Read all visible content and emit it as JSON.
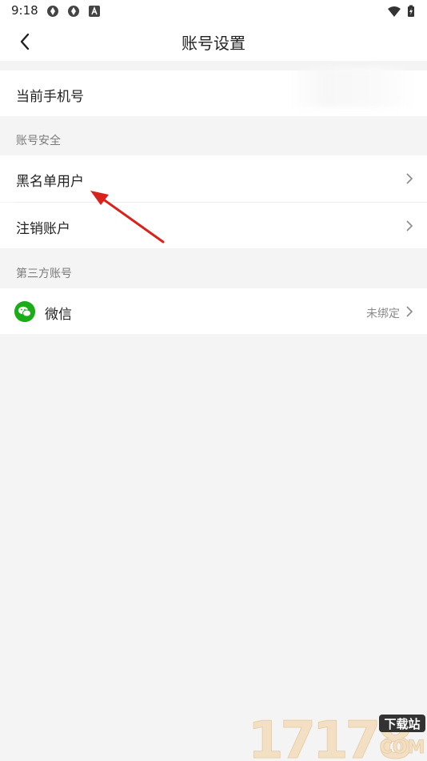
{
  "status": {
    "time": "9:18"
  },
  "header": {
    "title": "账号设置"
  },
  "account": {
    "phone_label": "当前手机号"
  },
  "security": {
    "section_title": "账号安全",
    "items": [
      {
        "label": "黑名单用户"
      },
      {
        "label": "注销账户"
      }
    ]
  },
  "third_party": {
    "section_title": "第三方账号",
    "wechat": {
      "label": "微信",
      "status": "未绑定"
    }
  },
  "watermark": {
    "number": "17178",
    "badge": "下载站",
    "domain": "COM"
  },
  "colors": {
    "background": "#f4f4f4",
    "wechat_green": "#1aad19",
    "annotation_red": "#d9221c"
  }
}
